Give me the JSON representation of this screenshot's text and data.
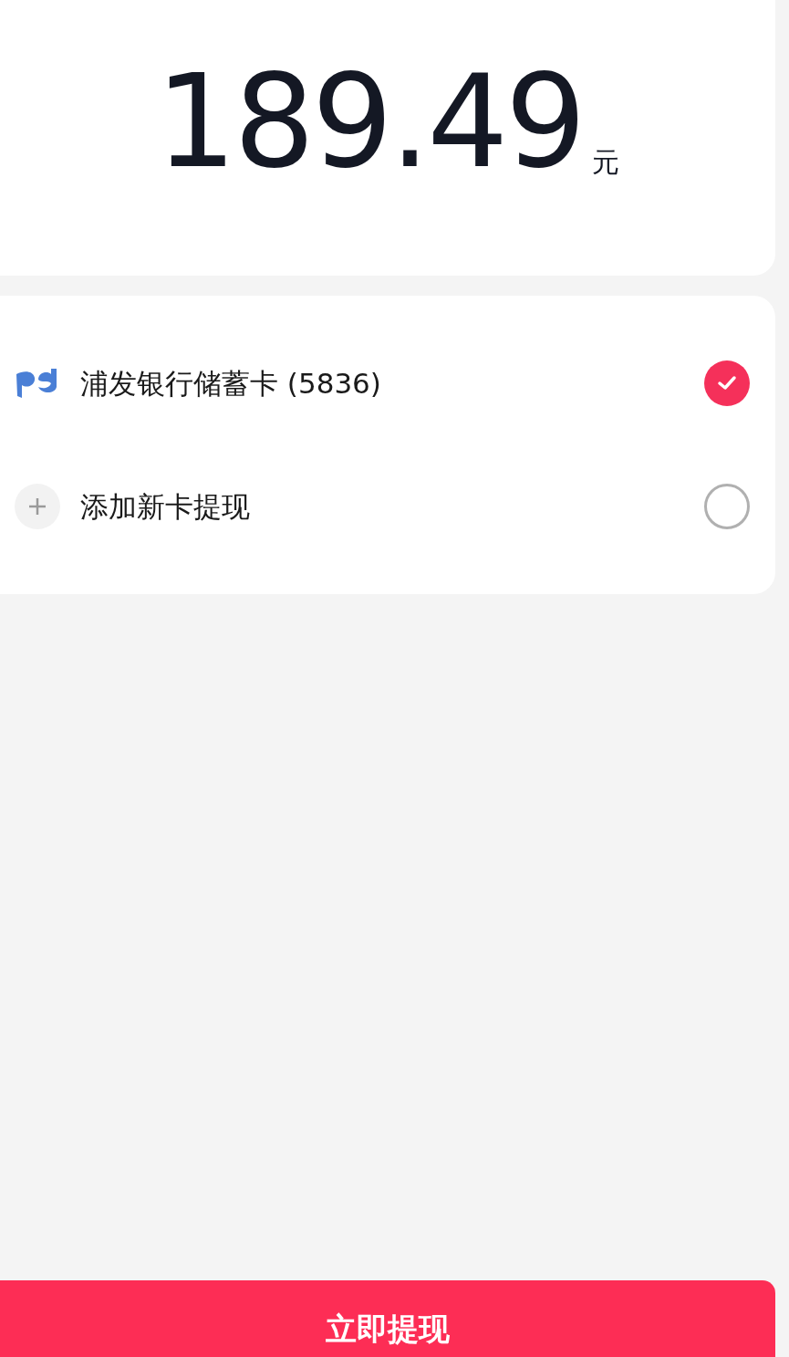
{
  "amount": {
    "value": "189.49",
    "unit": "元"
  },
  "cards": [
    {
      "kind": "bank",
      "label": "浦发银行储蓄卡 (5836)",
      "selected": true
    },
    {
      "kind": "add",
      "label": "添加新卡提现",
      "selected": false
    }
  ],
  "submit_button": "立即提现"
}
